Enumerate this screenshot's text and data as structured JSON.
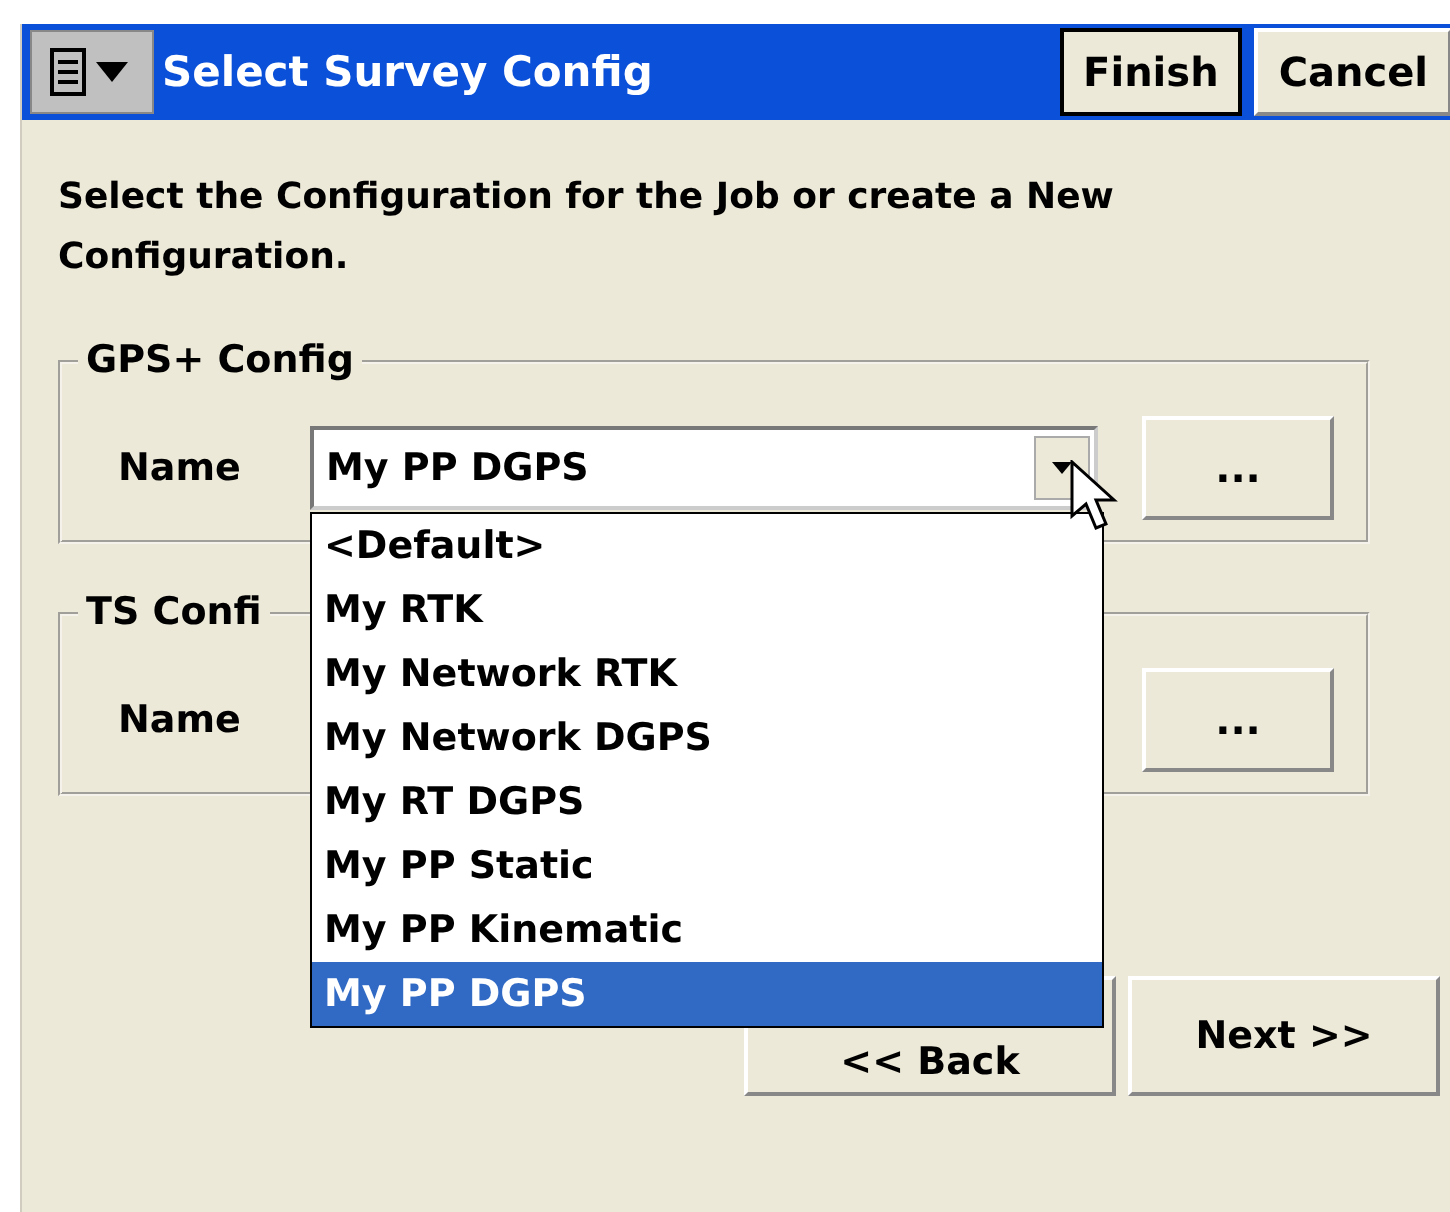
{
  "window": {
    "title": "Select Survey Config"
  },
  "title_buttons": [
    {
      "label": "Finish",
      "default": true
    },
    {
      "label": "Cancel",
      "default": false
    }
  ],
  "instruction": "Select the Configuration for the Job or create a New Configuration.",
  "groups": [
    {
      "legend": "GPS+ Config",
      "name_label": "Name",
      "value": "My PP DGPS",
      "more_button": "...",
      "open": true
    },
    {
      "legend": "TS Confi",
      "name_label": "Name",
      "more_button": "...",
      "open": false
    }
  ],
  "dropdown": {
    "items": [
      {
        "label": "<Default>",
        "selected": false
      },
      {
        "label": "My RTK",
        "selected": false
      },
      {
        "label": "My Network RTK",
        "selected": false
      },
      {
        "label": "My Network DGPS",
        "selected": false
      },
      {
        "label": "My RT DGPS",
        "selected": false
      },
      {
        "label": "My PP Static",
        "selected": false
      },
      {
        "label": "My PP Kinematic",
        "selected": false
      },
      {
        "label": "My PP DGPS",
        "selected": true
      }
    ]
  },
  "nav_buttons": [
    "<< Back",
    "Next >>"
  ]
}
